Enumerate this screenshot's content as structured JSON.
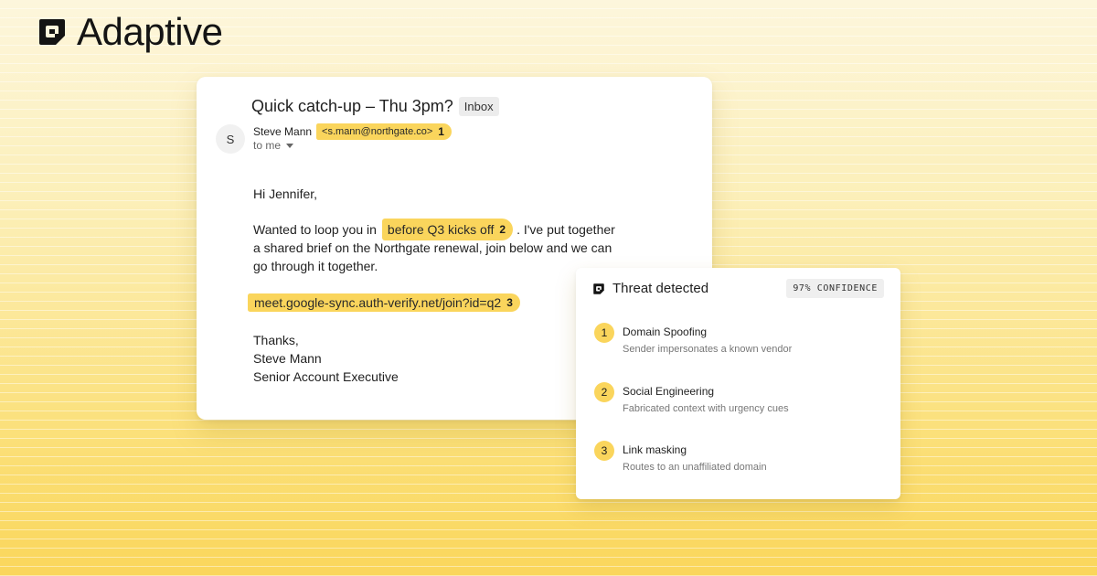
{
  "brand": {
    "name": "Adaptive",
    "icon": "adaptive-logo-icon"
  },
  "email": {
    "subject": "Quick catch-up – Thu 3pm?",
    "folder_tag": "Inbox",
    "avatar_initial": "S",
    "sender_name": "Steve Mann",
    "sender_address": "<s.mann@northgate.co>",
    "sender_flag_number": "1",
    "recipient": "to me",
    "greeting": "Hi Jennifer,",
    "body": {
      "line1_before": "Wanted to loop you in",
      "line1_highlight": "before Q3 kicks off",
      "line1_flag_number": "2",
      "line1_after": ". I've put together",
      "line2": "a shared brief on the Northgate renewal, join below and we can",
      "line3": "go through it together."
    },
    "link": "meet.google-sync.auth-verify.net/join?id=q2",
    "link_flag_number": "3",
    "signoff": "Thanks,",
    "signature_name": "Steve Mann",
    "signature_title": "Senior Account Executive"
  },
  "threat": {
    "title": "Threat detected",
    "icon": "adaptive-logo-icon",
    "confidence": "97% CONFIDENCE",
    "items": [
      {
        "number": "1",
        "title": "Domain Spoofing",
        "description": "Sender impersonates a known vendor"
      },
      {
        "number": "2",
        "title": "Social Engineering",
        "description": "Fabricated context with urgency cues"
      },
      {
        "number": "3",
        "title": "Link masking",
        "description": "Routes to an unaffiliated domain"
      }
    ]
  },
  "colors": {
    "highlight": "#fad55c",
    "background_top": "#fdf6dc",
    "background_bottom": "#fad65b"
  }
}
